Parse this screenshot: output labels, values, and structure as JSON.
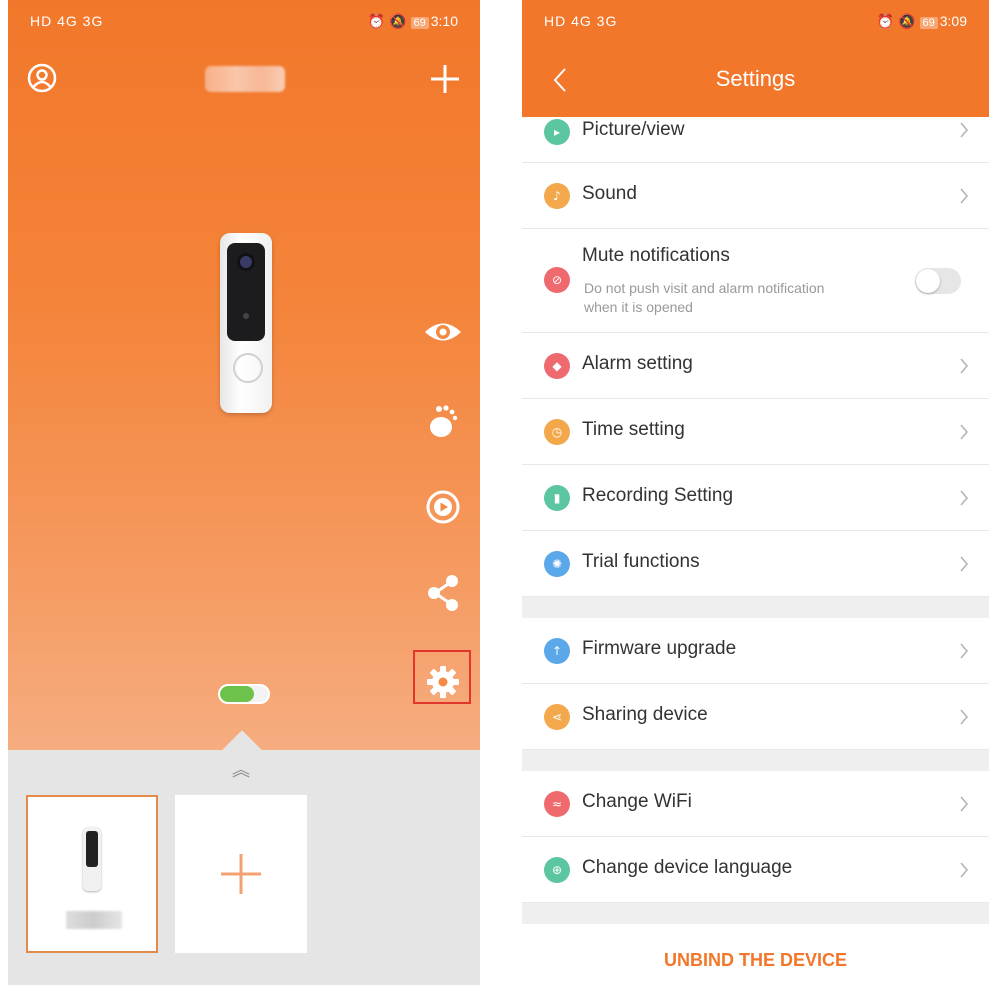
{
  "left": {
    "status": {
      "left": "HD 4G 3G",
      "battery": "69",
      "time": "3:10"
    },
    "device_battery_level": 0.7,
    "side_actions": [
      "eye-icon",
      "footprint-icon",
      "playback-icon",
      "share-icon",
      "settings-icon"
    ],
    "add_symbol": "+"
  },
  "right": {
    "status": {
      "left": "HD 4G 3G",
      "battery": "69",
      "time": "3:09"
    },
    "title": "Settings",
    "items": [
      {
        "label": "Picture/view",
        "color": "#5cc6a0",
        "icon": "picture-icon"
      },
      {
        "label": "Sound",
        "color": "#f3a84b",
        "icon": "sound-icon"
      },
      {
        "label": "Mute notifications",
        "color": "#ee6a6f",
        "icon": "mute-icon",
        "sub1": "Do not push visit and alarm notification",
        "sub2": "when it is opened",
        "toggle": false
      },
      {
        "label": "Alarm setting",
        "color": "#ee6a6f",
        "icon": "alarm-icon"
      },
      {
        "label": "Time setting",
        "color": "#f3a84b",
        "icon": "clock-icon"
      },
      {
        "label": "Recording Setting",
        "color": "#5cc6a0",
        "icon": "recording-icon"
      },
      {
        "label": "Trial functions",
        "color": "#5aa7ea",
        "icon": "bulb-icon"
      },
      {
        "label": "Firmware upgrade",
        "color": "#5aa7ea",
        "icon": "upgrade-icon"
      },
      {
        "label": "Sharing device",
        "color": "#f3a84b",
        "icon": "share-icon"
      },
      {
        "label": "Change WiFi",
        "color": "#ee6a6f",
        "icon": "wifi-icon"
      },
      {
        "label": "Change device language",
        "color": "#5cc6a0",
        "icon": "globe-icon"
      }
    ],
    "unbind": "UNBIND THE DEVICE"
  }
}
